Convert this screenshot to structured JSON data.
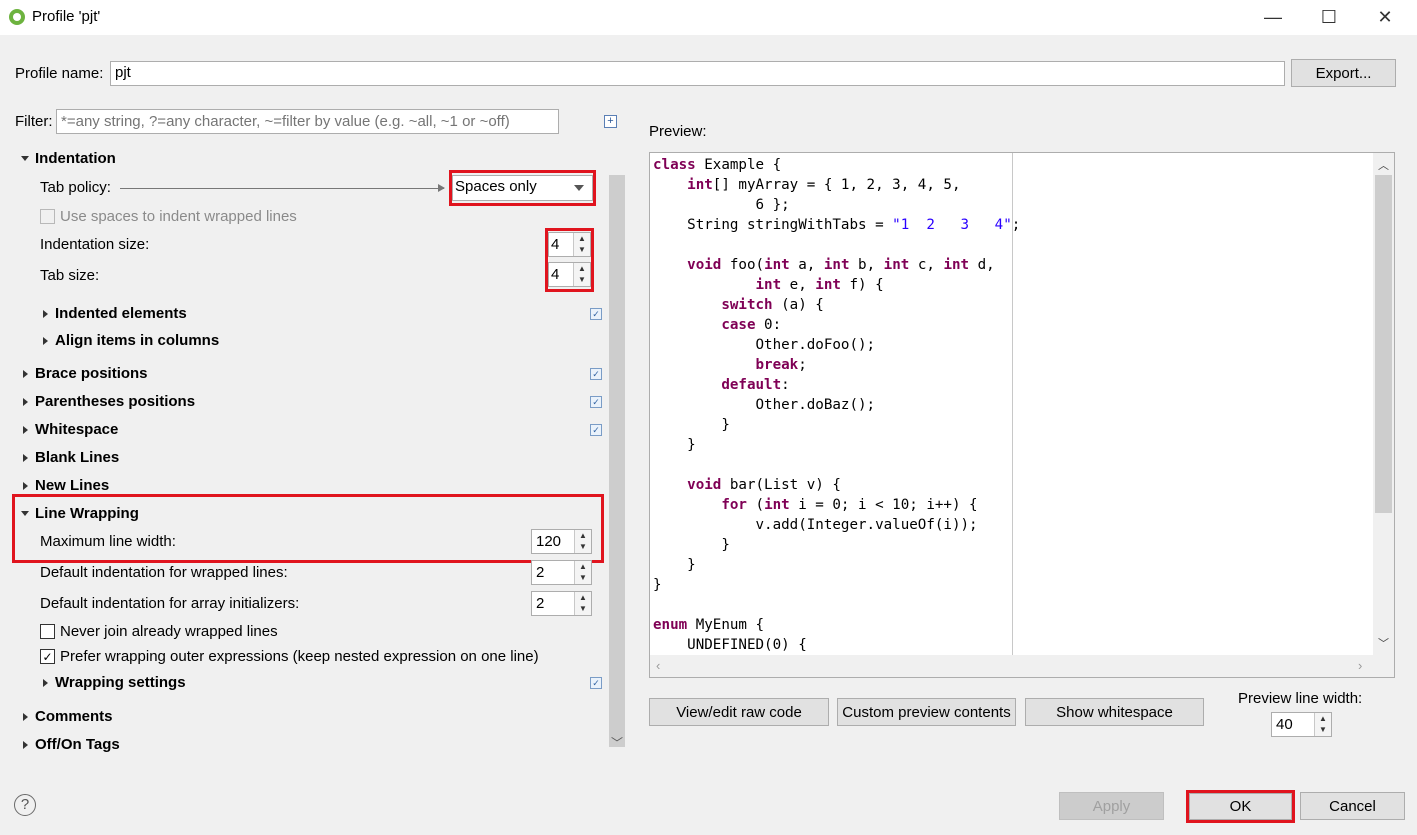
{
  "window": {
    "title": "Profile 'pjt'",
    "minimize_glyph": "—",
    "maximize_glyph": "☐",
    "close_glyph": "✕"
  },
  "profile": {
    "name_label": "Profile name:",
    "name_value": "pjt",
    "export_label": "Export..."
  },
  "filter": {
    "label": "Filter:",
    "placeholder": "*=any string, ?=any character, ~=filter by value (e.g. ~all, ~1 or ~off)"
  },
  "tree": {
    "indentation": {
      "title": "Indentation",
      "tab_policy_label": "Tab policy:",
      "tab_policy_value": "Spaces only",
      "use_spaces_label": "Use spaces to indent wrapped lines",
      "indentation_size_label": "Indentation size:",
      "indentation_size_value": "4",
      "tab_size_label": "Tab size:",
      "tab_size_value": "4",
      "indented_elements": "Indented elements",
      "align_items": "Align items in columns"
    },
    "brace_positions": "Brace positions",
    "parentheses_positions": "Parentheses positions",
    "whitespace": "Whitespace",
    "blank_lines": "Blank Lines",
    "new_lines": "New Lines",
    "line_wrapping": {
      "title": "Line Wrapping",
      "max_line_width_label": "Maximum line width:",
      "max_line_width_value": "120",
      "default_indent_wrapped_label": "Default indentation for wrapped lines:",
      "default_indent_wrapped_value": "2",
      "default_indent_array_label": "Default indentation for array initializers:",
      "default_indent_array_value": "2",
      "never_join_label": "Never join already wrapped lines",
      "prefer_wrapping_label": "Prefer wrapping outer expressions (keep nested expression on one line)",
      "wrapping_settings": "Wrapping settings"
    },
    "comments": "Comments",
    "off_on_tags": "Off/On Tags"
  },
  "preview": {
    "label": "Preview:",
    "code_lines": [
      "class Example {",
      "    int[] myArray = { 1, 2, 3, 4, 5,",
      "            6 };",
      "    String stringWithTabs = \"1  2   3   4\";",
      "",
      "    void foo(int a, int b, int c, int d,",
      "            int e, int f) {",
      "        switch (a) {",
      "        case 0:",
      "            Other.doFoo();",
      "            break;",
      "        default:",
      "            Other.doBaz();",
      "        }",
      "    }",
      "",
      "    void bar(List v) {",
      "        for (int i = 0; i < 10; i++) {",
      "            v.add(Integer.valueOf(i));",
      "        }",
      "    }",
      "}",
      "",
      "enum MyEnum {",
      "    UNDEFINED(0) {"
    ],
    "view_raw_label": "View/edit raw code",
    "custom_preview_label": "Custom preview contents",
    "show_whitespace_label": "Show whitespace",
    "line_width_label": "Preview line width:",
    "line_width_value": "40"
  },
  "footer": {
    "help_glyph": "?",
    "apply_label": "Apply",
    "ok_label": "OK",
    "cancel_label": "Cancel"
  }
}
